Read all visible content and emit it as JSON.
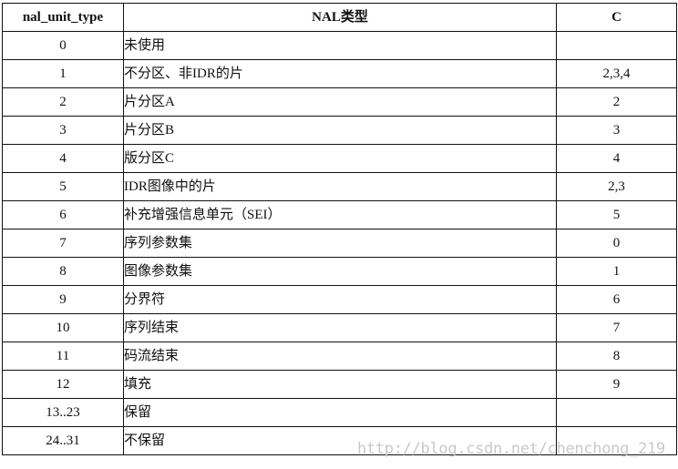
{
  "table": {
    "headers": [
      "nal_unit_type",
      "NAL类型",
      "C"
    ],
    "rows": [
      {
        "type": "0",
        "name": "未使用",
        "c": ""
      },
      {
        "type": "1",
        "name": "不分区、非IDR的片",
        "c": "2,3,4"
      },
      {
        "type": "2",
        "name": "片分区A",
        "c": "2"
      },
      {
        "type": "3",
        "name": "片分区B",
        "c": "3"
      },
      {
        "type": "4",
        "name": "版分区C",
        "c": "4"
      },
      {
        "type": "5",
        "name": "IDR图像中的片",
        "c": "2,3"
      },
      {
        "type": "6",
        "name": "补充增强信息单元（SEI）",
        "c": "5"
      },
      {
        "type": "7",
        "name": "序列参数集",
        "c": "0"
      },
      {
        "type": "8",
        "name": "图像参数集",
        "c": "1"
      },
      {
        "type": "9",
        "name": "分界符",
        "c": "6"
      },
      {
        "type": "10",
        "name": "序列结束",
        "c": "7"
      },
      {
        "type": "11",
        "name": "码流结束",
        "c": "8"
      },
      {
        "type": "12",
        "name": "填充",
        "c": "9"
      },
      {
        "type": "13..23",
        "name": "保留",
        "c": ""
      },
      {
        "type": "24..31",
        "name": "不保留",
        "c": ""
      }
    ]
  },
  "watermark": "http://blog.csdn.net/chenchong_219"
}
